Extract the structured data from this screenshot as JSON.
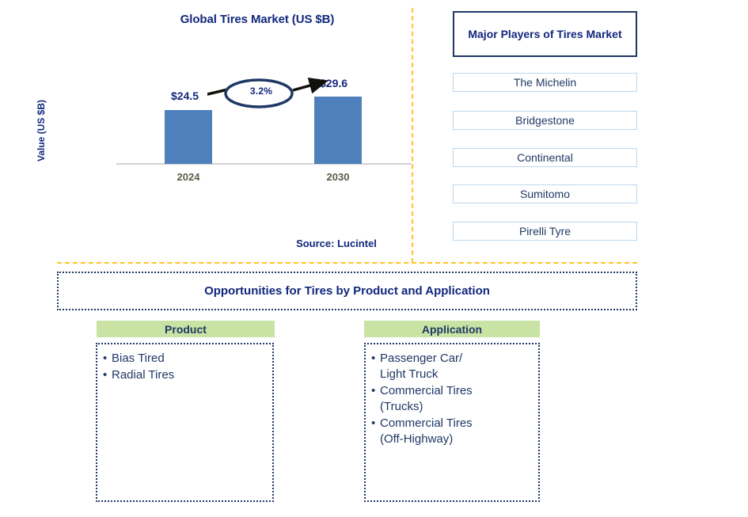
{
  "chart_data": {
    "type": "bar",
    "title": "Global Tires Market (US $B)",
    "categories": [
      "2024",
      "2030"
    ],
    "values": [
      24.5,
      29.6
    ],
    "value_labels": [
      "$24.5",
      "$29.6"
    ],
    "xlabel": "",
    "ylabel": "Value (US $B)",
    "ylim": [
      0,
      34
    ],
    "grid": false,
    "legend": "none",
    "bar_color": "#4E81BC",
    "annotation": {
      "cagr_label": "3.2%",
      "shape": "ellipse-with-arrow",
      "from_category": "2024",
      "to_category": "2030"
    },
    "source": "Source: Lucintel"
  },
  "chart_panel": {
    "title": "Global Tires Market (US $B)",
    "y_axis_label": "Value (US $B)",
    "bars": [
      {
        "category": "2024",
        "label": "$24.5",
        "value": 24.5
      },
      {
        "category": "2030",
        "label": "$29.6",
        "value": 29.6
      }
    ],
    "cagr": "3.2%",
    "source": "Source: Lucintel"
  },
  "players_panel": {
    "header": "Major Players of Tires Market",
    "items": [
      {
        "name": "The Michelin"
      },
      {
        "name": "Bridgestone"
      },
      {
        "name": "Continental"
      },
      {
        "name": "Sumitomo"
      },
      {
        "name": "Pirelli Tyre"
      }
    ]
  },
  "opportunities": {
    "banner": "Opportunities for Tires by Product and Application",
    "columns": [
      {
        "header": "Product",
        "items": [
          "Bias Tired",
          "Radial Tires"
        ]
      },
      {
        "header": "Application",
        "items": [
          "Passenger Car/\nLight Truck",
          "Commercial Tires\n(Trucks)",
          "Commercial Tires\n(Off-Highway)"
        ]
      }
    ]
  },
  "colors": {
    "bar_blue": "#4E81BC",
    "navy_text": "#12277D",
    "navy_border": "#1F3864",
    "gold_divider": "#FFC425",
    "header_green": "#C9E3A4",
    "player_border": "#BDD7EE",
    "tick_label": "#5B5B48"
  }
}
